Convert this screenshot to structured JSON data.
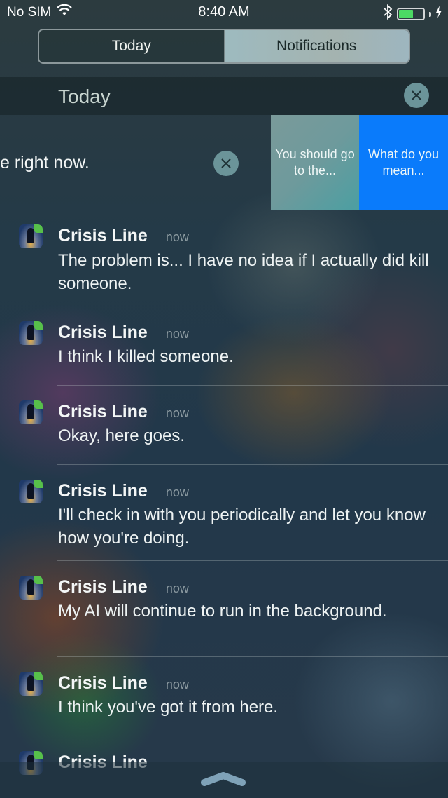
{
  "status_bar": {
    "carrier": "No SIM",
    "time": "8:40 AM",
    "battery_level": 0.6,
    "battery_color": "#4cd964",
    "icons": [
      "wifi-icon",
      "bluetooth-icon",
      "battery-icon",
      "charging-bolt-icon"
    ]
  },
  "segmented_control": {
    "tabs": [
      {
        "label": "Today",
        "selected": false
      },
      {
        "label": "Notifications",
        "selected": true
      }
    ]
  },
  "section": {
    "title": "Today",
    "clear_icon": "close-icon"
  },
  "swiped_notification": {
    "visible_text": "e right now.",
    "close_icon": "close-icon",
    "actions": [
      {
        "label": "You should go to the...",
        "color": "#6e9a9c"
      },
      {
        "label": "What do you mean...",
        "color": "#0a7bfb"
      }
    ]
  },
  "notifications": [
    {
      "app": "Crisis Line",
      "time": "now",
      "message": "The problem is... I have no idea if I actually did kill someone."
    },
    {
      "app": "Crisis Line",
      "time": "now",
      "message": "I think I killed someone."
    },
    {
      "app": "Crisis Line",
      "time": "now",
      "message": "Okay, here goes."
    },
    {
      "app": "Crisis Line",
      "time": "now",
      "message": "I'll check in with you periodically and let you know how you're doing."
    },
    {
      "app": "Crisis Line",
      "time": "now",
      "message": "My AI will continue to run in the background."
    },
    {
      "app": "Crisis Line",
      "time": "now",
      "message": "I think you've got it from here."
    },
    {
      "app": "Crisis Line",
      "time": "",
      "message": ""
    }
  ],
  "bottom": {
    "grabber_icon": "chevron-up-grabber-icon"
  }
}
